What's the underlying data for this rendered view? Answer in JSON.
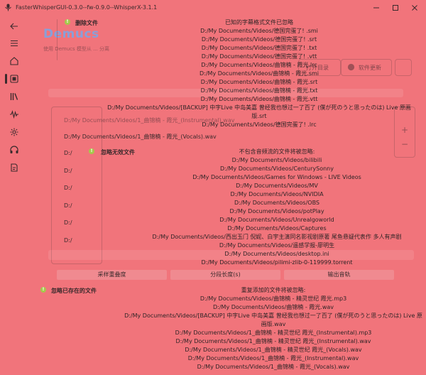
{
  "window": {
    "title": "FasterWhisperGUI-0.3.0--fw-0.9.0--WhisperX-3.1.1"
  },
  "sidebar": {
    "icons": [
      "back-icon",
      "menu-icon",
      "home-icon",
      "transcribe-icon",
      "library-icon",
      "waveform-icon",
      "settings-icon",
      "headphones-icon",
      "output-icon"
    ]
  },
  "background": {
    "logo": "Demucs",
    "subtitle": "使用 Demucs 模型从 ... 分离",
    "btn_dir": "打开目录",
    "btn_update": "软件更新",
    "rows": [
      "D:/My Documents/Videos/1_曲锦楠 - 霞光_(Instrumental).wav",
      "D:/My Documents/Videos/1_曲锦楠 - 霞光_(Vocals).wav",
      "D:/",
      "D:/",
      "D:/",
      "D:/",
      "D:/",
      "D:/"
    ]
  },
  "toolbar": {
    "overlap_label": "采样重叠度",
    "segment_label": "分段长度(s)",
    "output_label": "输出音轨"
  },
  "info_delete": {
    "title": "删除文件",
    "lines": [
      "已知的字幕格式文件已忽略",
      "D:/My Documents/Videos/德国完蛋了! .smi",
      "D:/My Documents/Videos/德国完蛋了! .srt",
      "D:/My Documents/Videos/德国完蛋了! .txt",
      "D:/My Documents/Videos/德国完蛋了! .vtt",
      "D:/My Documents/Videos/曲锦楠 - 霞光.lrc",
      "D:/My Documents/Videos/曲锦楠 - 霞光.smi",
      "D:/My Documents/Videos/曲锦楠 - 霞光.srt",
      "D:/My Documents/Videos/曲锦楠 - 霞光.txt",
      "D:/My Documents/Videos/曲锦楠 - 霞光.vtt",
      "D:/My Documents/Videos/[BACKUP] 中字Live 中岛美嘉 曾经我也想过一了百了 (僕が死のうと思ったのは) Live 原画版.srt",
      "D:/My Documents/Videos/德国完蛋了! .lrc"
    ]
  },
  "info_ignore": {
    "title": "忽略无效文件",
    "lines": [
      "不包含音频流的文件将被忽略:",
      "D:/My Documents/Videos/bilibili",
      "D:/My Documents/Videos/CenturySonny",
      "D:/My Documents/Videos/Games for Windows - LIVE Videos",
      "D:/My Documents/Videos/MV",
      "D:/My Documents/Videos/NVIDIA",
      "D:/My Documents/Videos/OBS",
      "D:/My Documents/Videos/potPlay",
      "D:/My Documents/Videos/Unrealgoworld",
      "D:/My Documents/Videos/Captures",
      "D:/My Documents/Videos/西出玉门 倪妮、白宇主演同名影视剧原著 尾鱼悬疑代表作 多人有声剧",
      "D:/My Documents/Videos/遥感学报-廖明生",
      "D:/My Documents/Videos/desktop.ini",
      "D:/My Documents/Videos/pilimi-zlib-0-119999.torrent"
    ]
  },
  "info_exists": {
    "title": "忽略已存在的文件",
    "lines": [
      "重复添加的文件将被忽略:",
      "D:/My Documents/Videos/曲锦楠 - 精灵世纪 霞光.mp3",
      "D:/My Documents/Videos/曲锦楠 - 霞光.wav",
      "D:/My Documents/Videos/[BACKUP] 中字Live 中岛美嘉 曾经我也想过一了百了 (僕が死のうと思ったのは) Live 原画版.wav",
      "D:/My Documents/Videos/1_曲锦楠 - 精灵世纪 霞光_(Instrumental).mp3",
      "D:/My Documents/Videos/1_曲锦楠 - 精灵世纪 霞光_(Instrumental).wav",
      "D:/My Documents/Videos/1_曲锦楠 - 精灵世纪 霞光_(Vocals).wav",
      "D:/My Documents/Videos/1_曲锦楠 - 霞光_(Instrumental).wav",
      "D:/My Documents/Videos/1_曲锦楠 - 霞光_(Vocals).wav"
    ]
  },
  "colors": {
    "background": "#f1747b",
    "info_icon": "#a6c84c",
    "logo": "#8a9fd8"
  }
}
